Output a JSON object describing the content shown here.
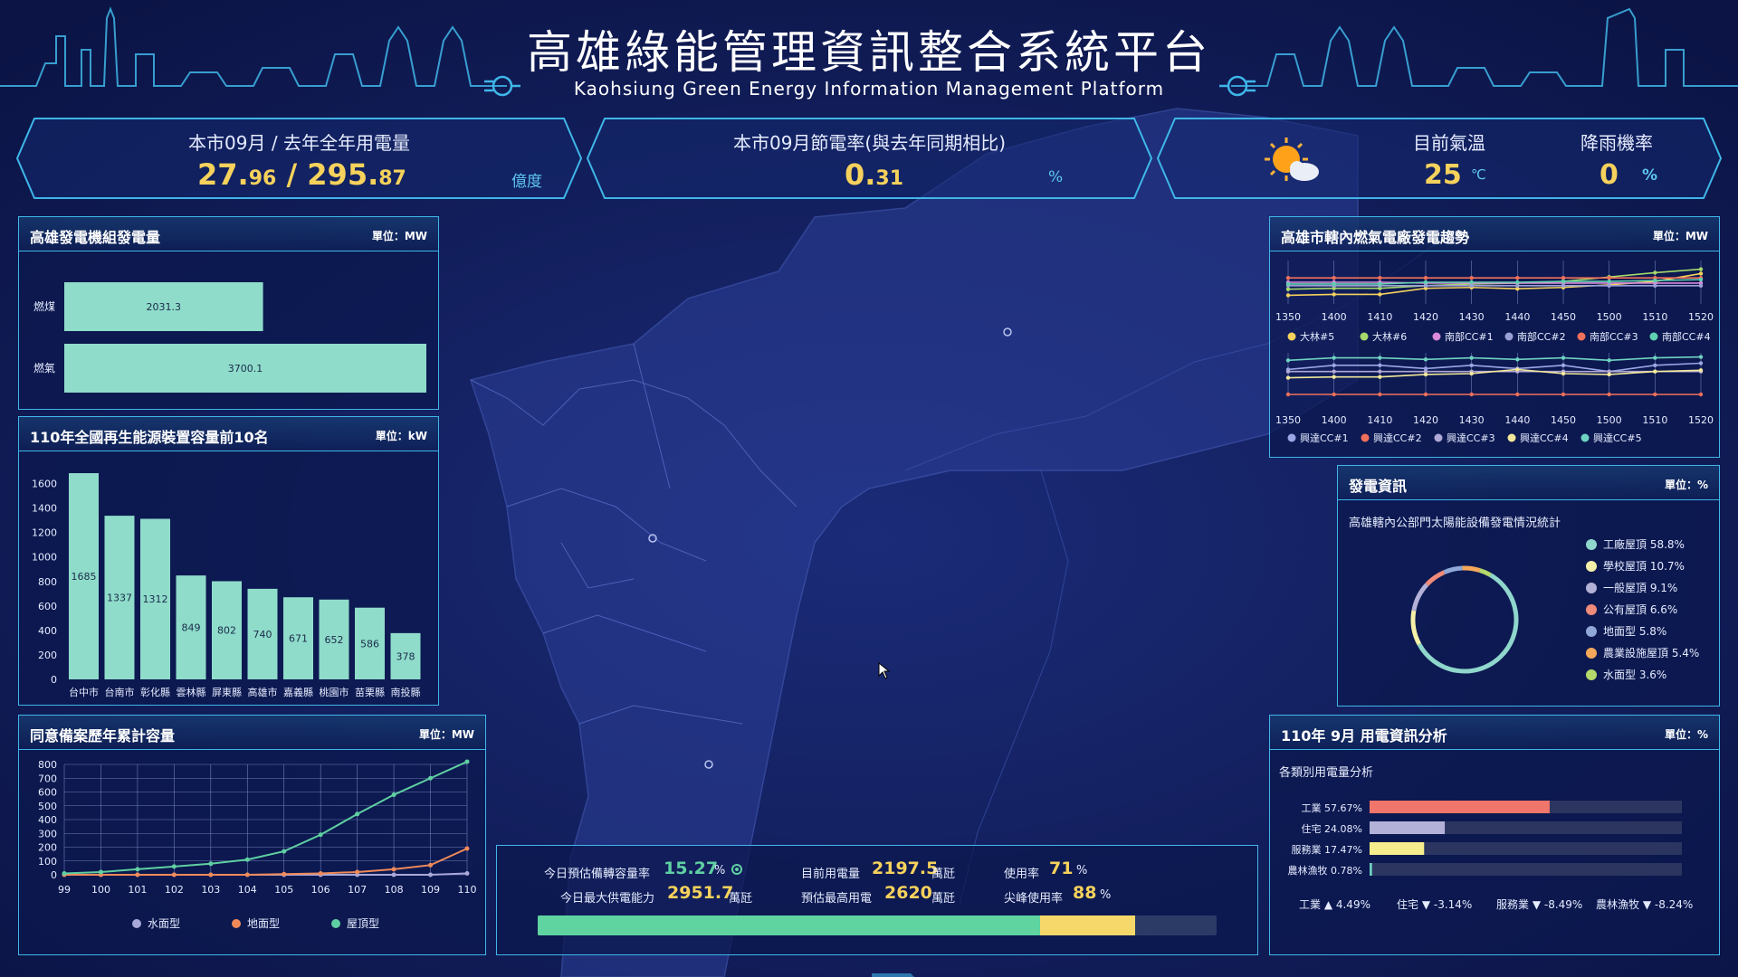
{
  "header": {
    "title": "高雄綠能管理資訊整合系統平台",
    "subtitle": "Kaohsiung Green Energy Information Management Platform"
  },
  "kpi": {
    "usage": {
      "label": "本市09月 / 去年全年用電量",
      "month_int": "27.",
      "month_dec": "96",
      "slash": " / ",
      "year_int": "295.",
      "year_dec": "87",
      "unit": "億度"
    },
    "saving": {
      "label": "本市09月節電率(與去年同期相比)",
      "int": "0.",
      "dec": "31",
      "unit": "%"
    },
    "weather": {
      "icon": "sun-cloud-icon",
      "temp_label": "目前氣溫",
      "temp": "25",
      "temp_unit": "℃",
      "rain_label": "降雨機率",
      "rain": "0",
      "rain_unit": "%"
    }
  },
  "panel1": {
    "title": "高雄發電機組發電量",
    "unit": "單位：MW",
    "chart_data": {
      "type": "bar",
      "orientation": "horizontal",
      "categories": [
        "燃煤",
        "燃氣"
      ],
      "values": [
        2031.3,
        3700.1
      ],
      "xlim": [
        0,
        3700.1
      ]
    }
  },
  "panel2": {
    "title": "110年全國再生能源裝置容量前10名",
    "unit": "單位：kW",
    "chart_data": {
      "type": "bar",
      "categories": [
        "台中市",
        "台南市",
        "彰化縣",
        "雲林縣",
        "屏東縣",
        "高雄市",
        "嘉義縣",
        "桃園市",
        "苗栗縣",
        "南投縣"
      ],
      "values": [
        1685,
        1337,
        1312,
        849,
        802,
        740,
        671,
        652,
        586,
        378
      ],
      "yticks": [
        0,
        200,
        400,
        600,
        800,
        1000,
        1200,
        1400,
        1600
      ],
      "ylim": [
        0,
        1700
      ]
    }
  },
  "panel3": {
    "title": "同意備案歷年累計容量",
    "unit": "單位：MW",
    "chart_data": {
      "type": "line",
      "x": [
        99,
        100,
        101,
        102,
        103,
        104,
        105,
        106,
        107,
        108,
        109,
        110
      ],
      "yticks": [
        0,
        100,
        200,
        300,
        400,
        500,
        600,
        700,
        800
      ],
      "ylim": [
        0,
        800
      ],
      "series": [
        {
          "name": "水面型",
          "color": "#a9a9d9",
          "values": [
            0,
            0,
            0,
            0,
            0,
            0,
            0,
            0,
            0,
            0,
            0,
            10
          ]
        },
        {
          "name": "地面型",
          "color": "#f08a5a",
          "values": [
            0,
            0,
            0,
            0,
            0,
            0,
            5,
            10,
            20,
            40,
            70,
            190
          ]
        },
        {
          "name": "屋頂型",
          "color": "#5fd0a2",
          "values": [
            10,
            20,
            40,
            60,
            80,
            110,
            170,
            290,
            440,
            580,
            700,
            820
          ]
        }
      ]
    }
  },
  "panel4": {
    "title": "高雄市轄內燃氣電廠發電趨勢",
    "unit": "單位：MW",
    "chart_data": [
      {
        "type": "line",
        "x": [
          "1350",
          "1400",
          "1410",
          "1420",
          "1430",
          "1440",
          "1450",
          "1500",
          "1510",
          "1520"
        ],
        "ylim": [
          0,
          100
        ],
        "series": [
          {
            "name": "大林#5",
            "color": "#f6d25c",
            "values": [
              20,
              22,
              22,
              36,
              38,
              35,
              38,
              44,
              52,
              70
            ]
          },
          {
            "name": "大林#6",
            "color": "#a6d96a",
            "values": [
              34,
              36,
              36,
              42,
              46,
              48,
              52,
              62,
              72,
              80
            ]
          },
          {
            "name": "南部CC#1",
            "color": "#d98ad9",
            "values": [
              50,
              50,
              50,
              48,
              48,
              48,
              48,
              48,
              48,
              48
            ]
          },
          {
            "name": "南部CC#2",
            "color": "#9aa0d6",
            "values": [
              42,
              42,
              42,
              42,
              42,
              42,
              42,
              42,
              42,
              42
            ]
          },
          {
            "name": "南部CC#3",
            "color": "#f0705a",
            "values": [
              60,
              60,
              60,
              60,
              60,
              60,
              60,
              60,
              60,
              60
            ]
          },
          {
            "name": "南部CC#4",
            "color": "#5fd0b0",
            "values": [
              46,
              46,
              46,
              50,
              50,
              50,
              52,
              52,
              54,
              56
            ]
          }
        ]
      },
      {
        "type": "line",
        "x": [
          "1350",
          "1400",
          "1410",
          "1420",
          "1430",
          "1440",
          "1450",
          "1500",
          "1510",
          "1520"
        ],
        "ylim": [
          0,
          100
        ],
        "series": [
          {
            "name": "興達CC#1",
            "color": "#9aa6e6",
            "values": [
              60,
              70,
              70,
              62,
              70,
              62,
              70,
              55,
              70,
              75
            ]
          },
          {
            "name": "興達CC#2",
            "color": "#f0705a",
            "values": [
              0,
              0,
              0,
              0,
              0,
              0,
              0,
              0,
              0,
              0
            ]
          },
          {
            "name": "興達CC#3",
            "color": "#b0a8d6",
            "values": [
              55,
              55,
              55,
              55,
              55,
              55,
              55,
              55,
              55,
              55
            ]
          },
          {
            "name": "興達CC#4",
            "color": "#f3e89a",
            "values": [
              40,
              42,
              42,
              48,
              50,
              60,
              50,
              48,
              55,
              58
            ]
          },
          {
            "name": "興達CC#5",
            "color": "#6fd3c2",
            "values": [
              82,
              88,
              88,
              84,
              88,
              84,
              88,
              82,
              88,
              90
            ]
          }
        ]
      }
    ]
  },
  "panel5": {
    "title": "發電資訊",
    "unit": "單位：%",
    "subtitle": "高雄轄內公部門太陽能設備發電情況統計",
    "chart_data": {
      "type": "pie",
      "donut": true,
      "slices": [
        {
          "label": "工廠屋頂 58.8%",
          "value": 58.8,
          "color": "#8fd6cc"
        },
        {
          "label": "學校屋頂 10.7%",
          "value": 10.7,
          "color": "#f5f0a8"
        },
        {
          "label": "一般屋頂 9.1%",
          "value": 9.1,
          "color": "#b4b1d8"
        },
        {
          "label": "公有屋頂 6.6%",
          "value": 6.6,
          "color": "#f08a7a"
        },
        {
          "label": "地面型 5.8%",
          "value": 5.8,
          "color": "#8fa8d8"
        },
        {
          "label": "農業設施屋頂 5.4%",
          "value": 5.4,
          "color": "#f5a85a"
        },
        {
          "label": "水面型 3.6%",
          "value": 3.6,
          "color": "#b5d96a"
        }
      ]
    }
  },
  "panel6": {
    "title": "110年 9月 用電資訊分析",
    "unit": "單位：%",
    "subtitle": "各類別用電量分析",
    "chart_data": {
      "type": "bar",
      "orientation": "horizontal",
      "categories": [
        "工業 57.67%",
        "住宅 24.08%",
        "服務業 17.47%",
        "農林漁牧 0.78%"
      ],
      "values": [
        57.67,
        24.08,
        17.47,
        0.78
      ],
      "colors": [
        "#f0756a",
        "#b4b1d8",
        "#f6ee8c",
        "#6fd3c2"
      ],
      "xlim": [
        0,
        100
      ]
    },
    "changes": [
      "工業 ▲ 4.49%",
      "住宅 ▼ -3.14%",
      "服務業 ▼ -8.49%",
      "農林漁牧 ▼ -8.24%"
    ]
  },
  "center": {
    "r1": {
      "l1": "今日預估備轉容量率",
      "v1": "15.27",
      "u1": "%",
      "l2": "目前用電量",
      "v2": "2197.5",
      "u2": "萬瓩",
      "l3": "使用率",
      "v3": "71",
      "u3": "%"
    },
    "r2": {
      "l1": "今日最大供電能力",
      "v1": "2951.7",
      "u1": "萬瓩",
      "l2": "預估最高用電",
      "v2": "2620",
      "u2": "萬瓩",
      "l3": "尖峰使用率",
      "v3": "88",
      "u3": "%"
    },
    "bar": {
      "green": 0.74,
      "yellow": 0.88
    }
  },
  "colors": {
    "accent": "#3fb6e8",
    "value": "#f6d25c",
    "bar": "#8fdcca",
    "bg": "#0f1a4f"
  }
}
